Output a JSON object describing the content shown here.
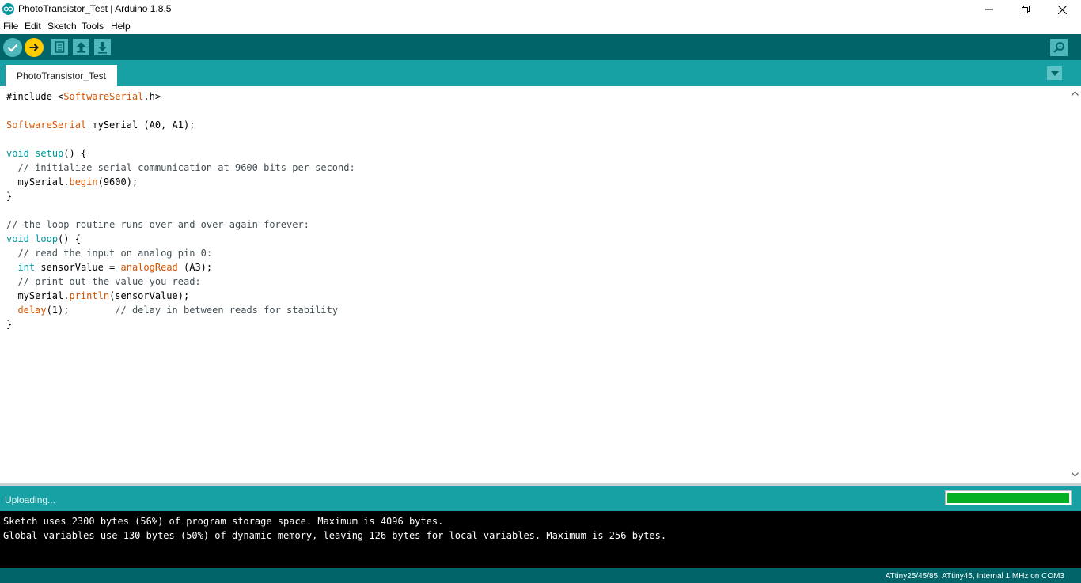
{
  "window": {
    "title": "PhotoTransistor_Test | Arduino 1.8.5"
  },
  "menu": [
    "File",
    "Edit",
    "Sketch",
    "Tools",
    "Help"
  ],
  "tabs": [
    {
      "label": "PhotoTransistor_Test"
    }
  ],
  "code_lines": [
    "#include <SoftwareSerial.h>",
    "",
    "SoftwareSerial mySerial (A0, A1);",
    "",
    "void setup() {",
    "  // initialize serial communication at 9600 bits per second:",
    "  mySerial.begin(9600);",
    "}",
    "",
    "// the loop routine runs over and over again forever:",
    "void loop() {",
    "  // read the input on analog pin 0:",
    "  int sensorValue = analogRead (A3);",
    "  // print out the value you read:",
    "  mySerial.println(sensorValue);",
    "  delay(1);        // delay in between reads for stability",
    "}"
  ],
  "status": {
    "text": "Uploading...",
    "progress": 1.0,
    "progress_color": "#06b025"
  },
  "console": {
    "lines": [
      "Sketch uses 2300 bytes (56%) of program storage space. Maximum is 4096 bytes.",
      "Global variables use 130 bytes (50%) of dynamic memory, leaving 126 bytes for local variables. Maximum is 256 bytes."
    ]
  },
  "footer": {
    "board": "ATtiny25/45/85, ATtiny45, Internal 1 MHz on COM3"
  },
  "colors": {
    "toolbar": "#006468",
    "tabbar": "#17a1a5",
    "verify_button": "#4db7bb",
    "upload_button": "#ffcc00"
  },
  "icons": {
    "verify": "check-icon",
    "upload": "arrow-right-icon",
    "new": "new-file-icon",
    "open": "arrow-up-icon",
    "save": "arrow-down-icon",
    "serial_monitor": "magnifier-icon"
  }
}
